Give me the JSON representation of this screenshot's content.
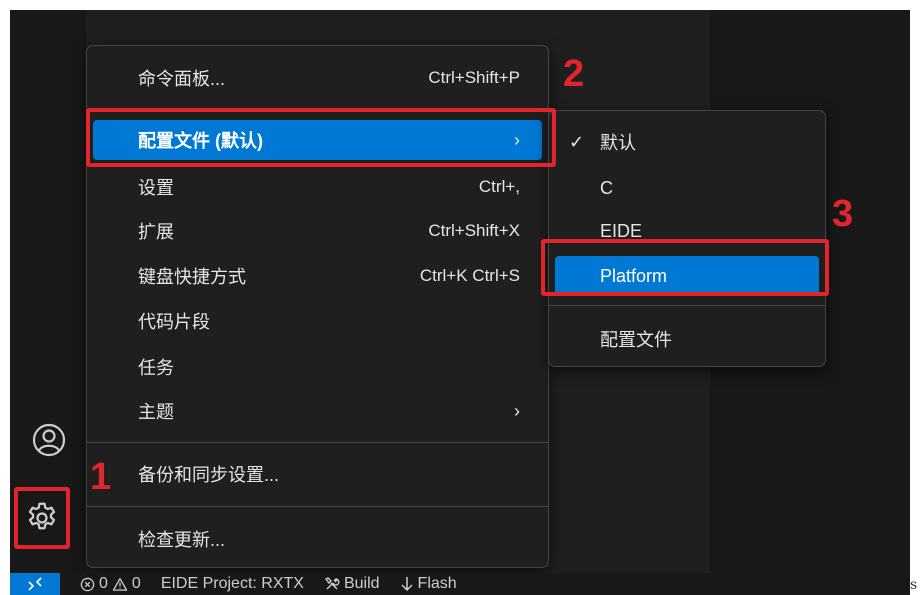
{
  "main_menu": {
    "items": [
      {
        "label": "命令面板...",
        "shortcut": "Ctrl+Shift+P"
      },
      {
        "label": "配置文件 (默认)",
        "submenu_arrow": "›"
      },
      {
        "label": "设置",
        "shortcut": "Ctrl+,"
      },
      {
        "label": "扩展",
        "shortcut": "Ctrl+Shift+X"
      },
      {
        "label": "键盘快捷方式",
        "shortcut": "Ctrl+K Ctrl+S"
      },
      {
        "label": "代码片段"
      },
      {
        "label": "任务"
      },
      {
        "label": "主题",
        "submenu_arrow": "›"
      },
      {
        "label": "备份和同步设置..."
      },
      {
        "label": "检查更新..."
      }
    ],
    "selected_item": "配置文件 (默认)"
  },
  "profile_submenu": {
    "checkmark": "✓",
    "items": [
      {
        "label": "默认",
        "checked": true
      },
      {
        "label": "C"
      },
      {
        "label": "EIDE"
      },
      {
        "label": "Platform"
      },
      {
        "label": "配置文件"
      }
    ],
    "selected_item": "Platform"
  },
  "annotations": {
    "step1": "1",
    "step2": "2",
    "step3": "3",
    "color": "#e1252b"
  },
  "status_bar": {
    "remote_icon": "remote-icon",
    "errors": "0",
    "warnings": "0",
    "project": "EIDE Project: RXTX",
    "build": "Build",
    "flash": "Flash",
    "trailing_glyph": "s"
  },
  "activity_bar": {
    "account_icon": "account-icon",
    "manage_icon": "gear-icon"
  },
  "colors": {
    "accent": "#0078d4",
    "menu_bg": "#1f1f1f",
    "annotation": "#e1252b"
  }
}
